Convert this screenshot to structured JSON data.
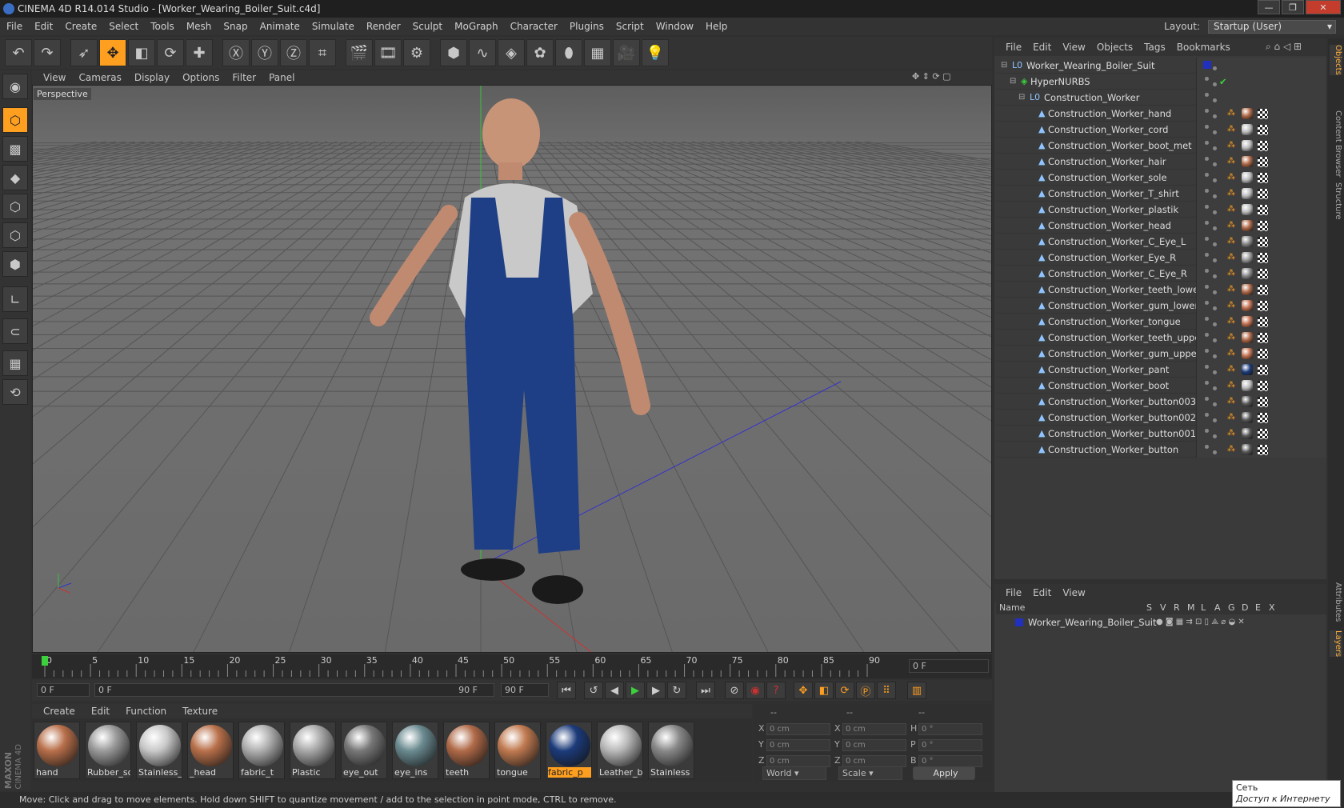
{
  "title": "CINEMA 4D R14.014 Studio - [Worker_Wearing_Boiler_Suit.c4d]",
  "menu": [
    "File",
    "Edit",
    "Create",
    "Select",
    "Tools",
    "Mesh",
    "Snap",
    "Animate",
    "Simulate",
    "Render",
    "Sculpt",
    "MoGraph",
    "Character",
    "Plugins",
    "Script",
    "Window",
    "Help"
  ],
  "layout": {
    "label": "Layout:",
    "value": "Startup (User)"
  },
  "viewport_menu": [
    "View",
    "Cameras",
    "Display",
    "Options",
    "Filter",
    "Panel"
  ],
  "viewport_label": "Perspective",
  "timeline": {
    "ticks": [
      "0",
      "5",
      "10",
      "15",
      "20",
      "25",
      "30",
      "35",
      "40",
      "45",
      "50",
      "55",
      "60",
      "65",
      "70",
      "75",
      "80",
      "85",
      "90"
    ],
    "current": "0 F"
  },
  "time_fields": {
    "start": "0 F",
    "range_start": "0 F",
    "range_end": "90 F",
    "end": "90 F"
  },
  "material_menu": [
    "Create",
    "Edit",
    "Function",
    "Texture"
  ],
  "materials": [
    {
      "label": "hand",
      "color": "#b86f4a"
    },
    {
      "label": "Rubber_so",
      "color": "#9a9a9a"
    },
    {
      "label": "Stainless_",
      "color": "#c8c8c8"
    },
    {
      "label": "_head",
      "color": "#b8704a"
    },
    {
      "label": "fabric_t",
      "color": "#b0b0b0"
    },
    {
      "label": "Plastic",
      "color": "#a8a8a8"
    },
    {
      "label": "eye_out",
      "color": "#777777"
    },
    {
      "label": "eye_ins",
      "color": "#6a8a90"
    },
    {
      "label": "teeth",
      "color": "#b06a48"
    },
    {
      "label": "tongue",
      "color": "#c07a50"
    },
    {
      "label": "fabric_p",
      "color": "#1c3b7a"
    },
    {
      "label": "Leather_bt",
      "color": "#b8b8b8"
    },
    {
      "label": "Stainless",
      "color": "#888888"
    }
  ],
  "coords": {
    "header": [
      "--",
      "--",
      "--"
    ],
    "rows": [
      {
        "a": "X",
        "av": "0 cm",
        "b": "X",
        "bv": "0 cm",
        "c": "H",
        "cv": "0 °"
      },
      {
        "a": "Y",
        "av": "0 cm",
        "b": "Y",
        "bv": "0 cm",
        "c": "P",
        "cv": "0 °"
      },
      {
        "a": "Z",
        "av": "0 cm",
        "b": "Z",
        "bv": "0 cm",
        "c": "B",
        "cv": "0 °"
      }
    ],
    "world": "World",
    "scale": "Scale",
    "apply": "Apply"
  },
  "status": "Move: Click and drag to move elements. Hold down SHIFT to quantize movement / add to the selection in point mode, CTRL to remove.",
  "object_menu": [
    "File",
    "Edit",
    "View",
    "Objects",
    "Tags",
    "Bookmarks"
  ],
  "objects": [
    {
      "name": "Worker_Wearing_Boiler_Suit",
      "level": 0,
      "icon": "null-icon"
    },
    {
      "name": "HyperNURBS",
      "level": 1,
      "icon": "hypernurbs-icon"
    },
    {
      "name": "Construction_Worker",
      "level": 2,
      "icon": "null-icon"
    },
    {
      "name": "Construction_Worker_hand",
      "level": 3,
      "icon": "polygon-icon",
      "tag": "#b06848"
    },
    {
      "name": "Construction_Worker_cord",
      "level": 3,
      "icon": "polygon-icon",
      "tag": "#bbbbbb"
    },
    {
      "name": "Construction_Worker_boot_met",
      "level": 3,
      "icon": "polygon-icon",
      "tag": "#bbbbbb"
    },
    {
      "name": "Construction_Worker_hair",
      "level": 3,
      "icon": "polygon-icon",
      "tag": "#b06848"
    },
    {
      "name": "Construction_Worker_sole",
      "level": 3,
      "icon": "polygon-icon",
      "tag": "#bbbbbb"
    },
    {
      "name": "Construction_Worker_T_shirt",
      "level": 3,
      "icon": "polygon-icon",
      "tag": "#bbbbbb"
    },
    {
      "name": "Construction_Worker_plastik",
      "level": 3,
      "icon": "polygon-icon",
      "tag": "#bbbbbb"
    },
    {
      "name": "Construction_Worker_head",
      "level": 3,
      "icon": "polygon-icon",
      "tag": "#b06848"
    },
    {
      "name": "Construction_Worker_C_Eye_L",
      "level": 3,
      "icon": "polygon-icon",
      "tag": "#888888"
    },
    {
      "name": "Construction_Worker_Eye_R",
      "level": 3,
      "icon": "polygon-icon",
      "tag": "#999999"
    },
    {
      "name": "Construction_Worker_C_Eye_R",
      "level": 3,
      "icon": "polygon-icon",
      "tag": "#888888"
    },
    {
      "name": "Construction_Worker_teeth_lower",
      "level": 3,
      "icon": "polygon-icon",
      "tag": "#b06848"
    },
    {
      "name": "Construction_Worker_gum_lower",
      "level": 3,
      "icon": "polygon-icon",
      "tag": "#c07050"
    },
    {
      "name": "Construction_Worker_tongue",
      "level": 3,
      "icon": "polygon-icon",
      "tag": "#c07050"
    },
    {
      "name": "Construction_Worker_teeth_upper",
      "level": 3,
      "icon": "polygon-icon",
      "tag": "#b06848"
    },
    {
      "name": "Construction_Worker_gum_upper",
      "level": 3,
      "icon": "polygon-icon",
      "tag": "#c07050"
    },
    {
      "name": "Construction_Worker_pant",
      "level": 3,
      "icon": "polygon-icon",
      "tag": "#1c3b7a"
    },
    {
      "name": "Construction_Worker_boot",
      "level": 3,
      "icon": "polygon-icon",
      "tag": "#bbbbbb"
    },
    {
      "name": "Construction_Worker_button003",
      "level": 3,
      "icon": "polygon-icon",
      "tag": "#555555"
    },
    {
      "name": "Construction_Worker_button002",
      "level": 3,
      "icon": "polygon-icon",
      "tag": "#555555"
    },
    {
      "name": "Construction_Worker_button001",
      "level": 3,
      "icon": "polygon-icon",
      "tag": "#555555"
    },
    {
      "name": "Construction_Worker_button",
      "level": 3,
      "icon": "polygon-icon",
      "tag": "#555555"
    }
  ],
  "layer_menu": [
    "File",
    "Edit",
    "View"
  ],
  "layer_header": [
    "Name",
    "S",
    "V",
    "R",
    "M",
    "L",
    "A",
    "G",
    "D",
    "E",
    "X"
  ],
  "layer_row": "Worker_Wearing_Boiler_Suit",
  "side_tabs": [
    "Objects",
    "Content Browser",
    "Structure",
    "Attributes",
    "Layers"
  ],
  "tooltip": {
    "line1": "Сеть",
    "line2": "Доступ к Интернету"
  },
  "branding": {
    "line1": "MAXON",
    "line2": "CINEMA 4D"
  },
  "colors": {
    "accent": "#ff9f20",
    "selection": "#ff9f20",
    "axis_x": "#c03030",
    "axis_y": "#30c030",
    "axis_z": "#3030c0"
  }
}
